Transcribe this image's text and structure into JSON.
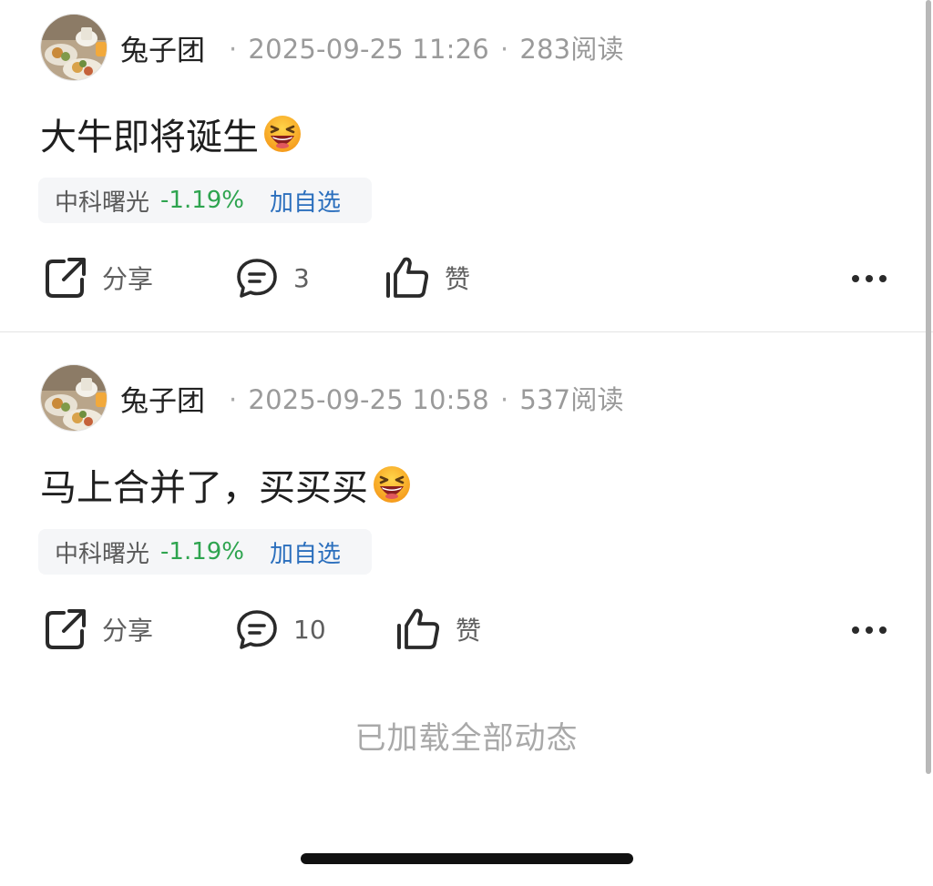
{
  "posts": [
    {
      "author": "兔子团",
      "datetime": "2025-09-25 11:26",
      "reads": "283阅读",
      "content": "大牛即将诞生",
      "emoji": "grinning-squinting-face-emoji",
      "stock": {
        "name": "中科曙光",
        "change": "-1.19%",
        "add_label": "加自选"
      },
      "actions": {
        "share_label": "分享",
        "comment_count": "3",
        "like_label": "赞"
      }
    },
    {
      "author": "兔子团",
      "datetime": "2025-09-25 10:58",
      "reads": "537阅读",
      "content": "马上合并了，买买买",
      "emoji": "grinning-squinting-face-emoji",
      "stock": {
        "name": "中科曙光",
        "change": "-1.19%",
        "add_label": "加自选"
      },
      "actions": {
        "share_label": "分享",
        "comment_count": "10",
        "like_label": "赞"
      }
    }
  ],
  "footer": {
    "text": "已加载全部动态"
  },
  "colors": {
    "negative": "#2ea44f",
    "link": "#2b6fbd",
    "muted": "#9a9a9a"
  },
  "icons": [
    "share-icon",
    "comment-icon",
    "thumbs-up-icon",
    "more-icon",
    "avatar-image"
  ]
}
